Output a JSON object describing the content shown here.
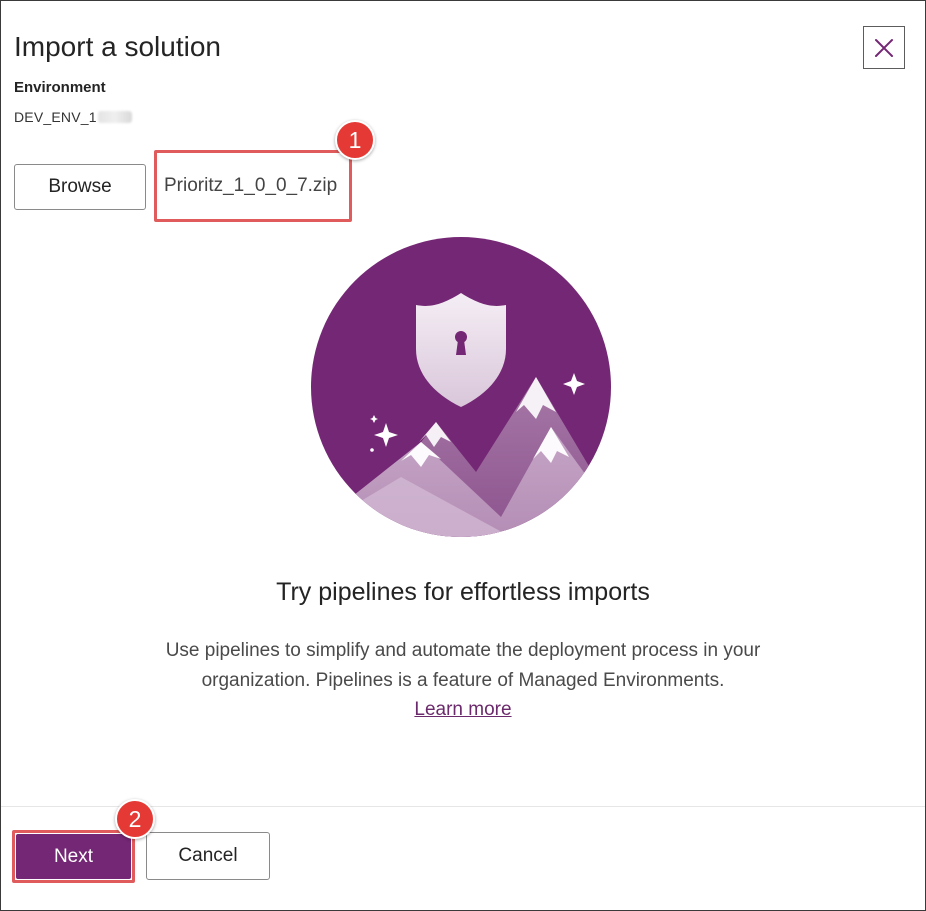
{
  "dialog": {
    "title": "Import a solution",
    "close_icon": "close-icon"
  },
  "environment": {
    "label": "Environment",
    "value": "DEV_ENV_1"
  },
  "file_picker": {
    "browse_label": "Browse",
    "file_name": "Prioritz_1_0_0_7.zip"
  },
  "annotations": {
    "step1": "1",
    "step2": "2",
    "highlight_color": "#e05c5c",
    "badge_color": "#e53935"
  },
  "promo": {
    "illustration_icon": "shield-mountains-illustration",
    "title": "Try pipelines for effortless imports",
    "body": "Use pipelines to simplify and automate the deployment process in your organization. Pipelines is a feature of Managed Environments.",
    "link_label": "Learn more"
  },
  "footer": {
    "next_label": "Next",
    "cancel_label": "Cancel"
  },
  "colors": {
    "accent": "#742774",
    "link": "#6b2a6b",
    "illustration_bg": "#742774"
  }
}
